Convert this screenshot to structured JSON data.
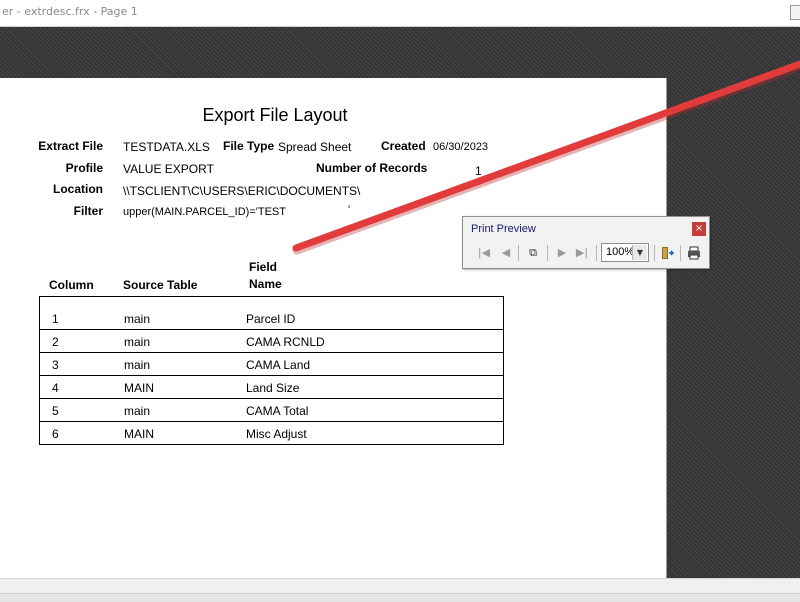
{
  "window": {
    "title": "er - extrdesc.frx - Page 1"
  },
  "report": {
    "title": "Export File Layout",
    "extract_file_label": "Extract File",
    "extract_file_value": "TESTDATA.XLS",
    "file_type_label": "File Type",
    "file_type_value": "Spread Sheet",
    "created_label": "Created",
    "created_value": "06/30/2023",
    "profile_label": "Profile",
    "profile_value": "VALUE EXPORT",
    "num_records_label": "Number of Records",
    "num_records_value": "1",
    "location_label": "Location",
    "location_value": "\\\\TSCLIENT\\C\\USERS\\ERIC\\DOCUMENTS\\",
    "filter_label": "Filter",
    "filter_value": "upper(MAIN.PARCEL_ID)='TEST",
    "filter_extra": "'",
    "headers": {
      "column": "Column",
      "source_table": "Source Table",
      "field_line1": "Field",
      "field_line2": "Name"
    },
    "rows": [
      {
        "col": "1",
        "table": "main",
        "field": "Parcel ID"
      },
      {
        "col": "2",
        "table": "main",
        "field": "CAMA RCNLD"
      },
      {
        "col": "3",
        "table": "main",
        "field": "CAMA Land"
      },
      {
        "col": "4",
        "table": "MAIN",
        "field": "Land Size"
      },
      {
        "col": "5",
        "table": "main",
        "field": "CAMA Total"
      },
      {
        "col": "6",
        "table": "MAIN",
        "field": "Misc Adjust"
      }
    ]
  },
  "print_preview": {
    "title": "Print Preview",
    "close_glyph": "×",
    "zoom_value": "100%",
    "icons": [
      "first-page-icon",
      "previous-page-icon",
      "multiple-pages-icon",
      "next-page-icon",
      "last-page-icon",
      "close-preview-icon",
      "print-icon"
    ]
  },
  "colors": {
    "annotation_arrow": "#e23b3b",
    "page_bg": "#ffffff",
    "backdrop": "#343434"
  }
}
